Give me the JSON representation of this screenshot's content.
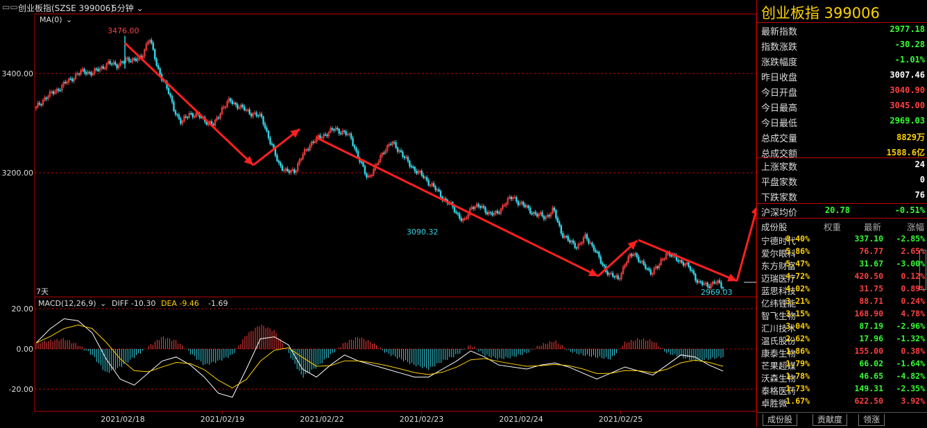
{
  "topbar": {
    "window_icon": "window-icon",
    "name": "创业板指(SZSE 399006)",
    "period": "5分钟",
    "ma_label": "MA(0)",
    "days_label": "7天"
  },
  "price_axis": {
    "labels": [
      "3400.00",
      "3200.00"
    ]
  },
  "annotations": {
    "high": "3476.00",
    "mid_low": "3090.32",
    "low": "2969.03"
  },
  "macd": {
    "title": "MACD(12,26,9)",
    "diff": "DIFF -10.30",
    "dea": "DEA -9.46",
    "macd_val": "-1.69",
    "axis": [
      "20.00",
      "0.00",
      "-20.00"
    ]
  },
  "dates": [
    "2021/02/18",
    "2021/02/19",
    "2021/02/22",
    "2021/02/23",
    "2021/02/24",
    "2021/02/25"
  ],
  "colors": {
    "up": "#ff4040",
    "down": "#33d6e6",
    "gold": "#ffd200",
    "green": "#33ff33",
    "arrow": "#ff2020"
  },
  "panel": {
    "title": "创业板指  399006",
    "stats": [
      {
        "label": "最新指数",
        "value": "2977.18",
        "color": "#33ff33"
      },
      {
        "label": "指数涨跌",
        "value": "-30.28",
        "color": "#33ff33"
      },
      {
        "label": "涨跌幅度",
        "value": "-1.01%",
        "color": "#33ff33"
      },
      {
        "label": "昨日收盘",
        "value": "3007.46",
        "color": "#ffffff"
      },
      {
        "label": "今日开盘",
        "value": "3040.90",
        "color": "#ff4040"
      },
      {
        "label": "今日最高",
        "value": "3045.00",
        "color": "#ff4040"
      },
      {
        "label": "今日最低",
        "value": "2969.03",
        "color": "#33ff33"
      },
      {
        "label": "总成交量",
        "value": "8829万",
        "color": "#ffd200"
      },
      {
        "label": "总成交额",
        "value": "1588.6亿",
        "color": "#ffd200"
      }
    ],
    "breadth": [
      {
        "label": "上涨家数",
        "value": "24",
        "color": "#ffffff"
      },
      {
        "label": "平盘家数",
        "value": "0",
        "color": "#ffffff"
      },
      {
        "label": "下跌家数",
        "value": "76",
        "color": "#ffffff"
      }
    ],
    "hs_avg": {
      "label": "沪深均价",
      "value": "20.78",
      "change": "-0.51%"
    },
    "stock_header": {
      "name": "成份股",
      "weight": "权重",
      "price": "最新",
      "change": "涨幅"
    },
    "stocks": [
      {
        "name": "宁德时代",
        "weight": "8.40%",
        "price": "337.10",
        "change": "-2.85%",
        "dir": "down"
      },
      {
        "name": "爱尔眼科",
        "weight": "5.86%",
        "price": "76.77",
        "change": "2.65%",
        "dir": "up"
      },
      {
        "name": "东方财富",
        "weight": "5.47%",
        "price": "31.67",
        "change": "-3.00%",
        "dir": "down"
      },
      {
        "name": "迈瑞医疗",
        "weight": "4.72%",
        "price": "420.50",
        "change": "0.12%",
        "dir": "up"
      },
      {
        "name": "蓝思科技",
        "weight": "4.02%",
        "price": "31.75",
        "change": "0.89%",
        "dir": "up"
      },
      {
        "name": "亿纬锂能",
        "weight": "3.21%",
        "price": "88.71",
        "change": "0.24%",
        "dir": "up"
      },
      {
        "name": "智飞生物",
        "weight": "3.15%",
        "price": "168.90",
        "change": "4.78%",
        "dir": "up"
      },
      {
        "name": "汇川技术",
        "weight": "3.04%",
        "price": "87.19",
        "change": "-2.96%",
        "dir": "down"
      },
      {
        "name": "温氏股份",
        "weight": "2.62%",
        "price": "17.96",
        "change": "-1.32%",
        "dir": "down"
      },
      {
        "name": "康泰生物",
        "weight": "1.86%",
        "price": "155.00",
        "change": "0.38%",
        "dir": "up"
      },
      {
        "name": "芒果超媒",
        "weight": "1.79%",
        "price": "66.02",
        "change": "-1.64%",
        "dir": "down"
      },
      {
        "name": "沃森生物",
        "weight": "1.78%",
        "price": "46.65",
        "change": "-4.82%",
        "dir": "down"
      },
      {
        "name": "泰格医药",
        "weight": "1.73%",
        "price": "149.31",
        "change": "-2.35%",
        "dir": "down"
      },
      {
        "name": "卓胜微",
        "weight": "1.67%",
        "price": "622.50",
        "change": "3.92%",
        "dir": "up"
      }
    ],
    "tabs": [
      "成份股",
      "贡献度",
      "领涨"
    ]
  },
  "price_path": [
    3330,
    3350,
    3360,
    3372,
    3385,
    3398,
    3405,
    3400,
    3412,
    3420,
    3418,
    3425,
    3430,
    3428,
    3476,
    3410,
    3380,
    3330,
    3300,
    3320,
    3315,
    3305,
    3295,
    3330,
    3345,
    3335,
    3325,
    3318,
    3310,
    3260,
    3220,
    3200,
    3205,
    3235,
    3260,
    3270,
    3280,
    3288,
    3282,
    3270,
    3225,
    3190,
    3210,
    3245,
    3260,
    3245,
    3220,
    3205,
    3190,
    3175,
    3155,
    3140,
    3120,
    3100,
    3135,
    3130,
    3120,
    3115,
    3140,
    3150,
    3138,
    3125,
    3115,
    3110,
    3125,
    3080,
    3060,
    3052,
    3070,
    3050,
    3015,
    2995,
    2985,
    3020,
    3040,
    3015,
    3000,
    3010,
    3040,
    3028,
    3020,
    3005,
    2978,
    2972,
    2980,
    2970
  ],
  "diff_path": [
    3,
    10,
    15,
    14,
    8,
    -5,
    -15,
    -18,
    -12,
    -6,
    -4,
    -8,
    -14,
    -22,
    -24,
    -10,
    5,
    6,
    2,
    -10,
    -14,
    -8,
    -3,
    -6,
    -8,
    -10,
    -12,
    -14,
    -14,
    -10,
    -6,
    -1,
    -4,
    -8,
    -9,
    -10,
    -8,
    -7,
    -9,
    -12,
    -15,
    -12,
    -9,
    -11,
    -13,
    -8,
    -3,
    -4,
    -8,
    -11
  ],
  "macd_bars": [
    3,
    4,
    5,
    2,
    -3,
    -12,
    -9,
    -4,
    1,
    6,
    4,
    -2,
    -8,
    -6,
    -3,
    7,
    12,
    9,
    -2,
    -14,
    -9,
    -3,
    3,
    6,
    3,
    -2,
    -5,
    -8,
    -10,
    -6,
    -3,
    2,
    -3,
    -5,
    -4,
    -2,
    2,
    4,
    -1,
    -3,
    -4,
    -5,
    3,
    5,
    4,
    -2,
    -4,
    -6,
    -5,
    -4
  ],
  "arrows": [
    [
      180,
      62,
      365,
      238
    ],
    [
      365,
      238,
      432,
      186
    ],
    [
      455,
      198,
      862,
      398
    ],
    [
      862,
      398,
      918,
      347
    ],
    [
      920,
      346,
      1062,
      405
    ],
    [
      1062,
      405,
      1092,
      296
    ],
    [
      1092,
      296,
      1130,
      316
    ],
    [
      1130,
      316,
      1167,
      230
    ]
  ]
}
